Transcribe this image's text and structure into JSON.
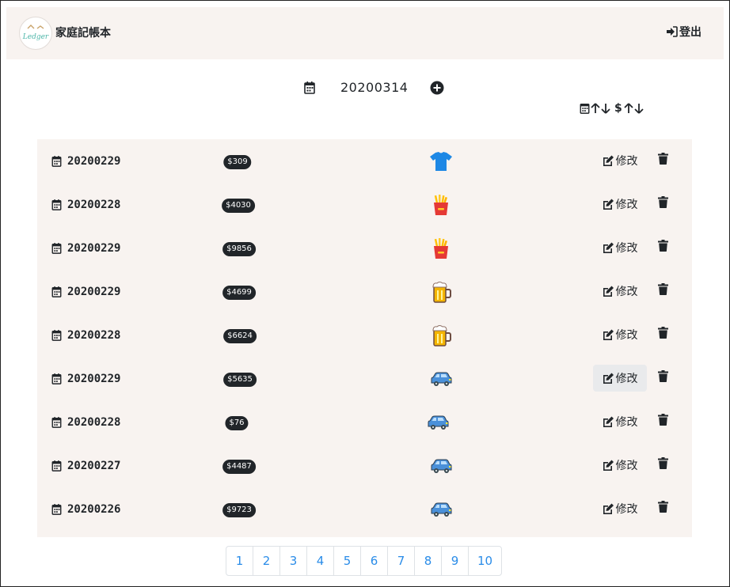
{
  "header": {
    "logo_text": "Ledger",
    "brand": "家庭記帳本",
    "logout_label": "登出"
  },
  "toolbar": {
    "date": "20200314"
  },
  "sort": {
    "currency_symbol": "$"
  },
  "records": [
    {
      "date": "20200229",
      "amount": "$309",
      "category_icon": "tshirt-icon"
    },
    {
      "date": "20200228",
      "amount": "$4030",
      "category_icon": "fries-icon"
    },
    {
      "date": "20200229",
      "amount": "$9856",
      "category_icon": "fries-icon"
    },
    {
      "date": "20200229",
      "amount": "$4699",
      "category_icon": "beer-icon"
    },
    {
      "date": "20200228",
      "amount": "$6624",
      "category_icon": "beer-icon"
    },
    {
      "date": "20200229",
      "amount": "$5635",
      "category_icon": "car-icon"
    },
    {
      "date": "20200228",
      "amount": "$76",
      "category_icon": "car-icon"
    },
    {
      "date": "20200227",
      "amount": "$4487",
      "category_icon": "car-icon"
    },
    {
      "date": "20200226",
      "amount": "$9723",
      "category_icon": "car-icon"
    }
  ],
  "record_actions": {
    "edit_label": "修改"
  },
  "pagination": {
    "pages": [
      "1",
      "2",
      "3",
      "4",
      "5",
      "6",
      "7",
      "8",
      "9",
      "10"
    ]
  },
  "colors": {
    "panel_bg": "#f8f3f0",
    "badge_bg": "#212529",
    "link_blue": "#2a8ce8",
    "tshirt": "#1e88e5",
    "fries_box": "#e53935",
    "beer": "#f4b400",
    "car": "#4a90d9"
  }
}
